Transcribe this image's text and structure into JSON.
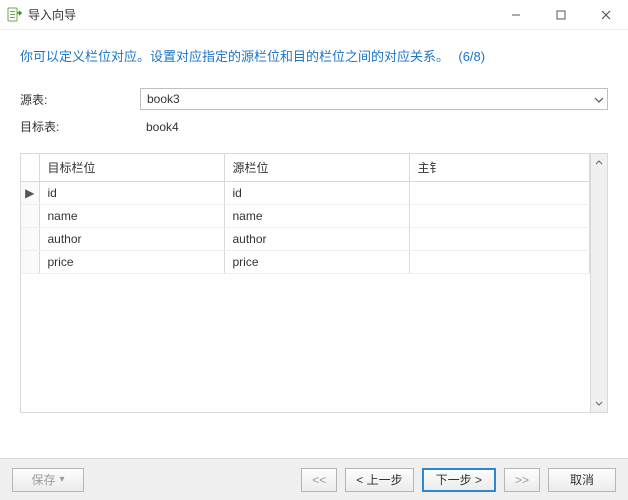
{
  "window": {
    "title": "导入向导"
  },
  "description": {
    "text": "你可以定义栏位对应。设置对应指定的源栏位和目的栏位之间的对应关系。",
    "step": "(6/8)"
  },
  "form": {
    "source_label": "源表:",
    "source_value": "book3",
    "target_label": "目标表:",
    "target_value": "book4"
  },
  "table": {
    "headers": {
      "target": "目标栏位",
      "source": "源栏位",
      "pk": "主钅"
    },
    "rows": [
      {
        "target": "id",
        "source": "id",
        "current": true
      },
      {
        "target": "name",
        "source": "name",
        "current": false
      },
      {
        "target": "author",
        "source": "author",
        "current": false
      },
      {
        "target": "price",
        "source": "price",
        "current": false
      }
    ]
  },
  "footer": {
    "save": "保存",
    "first": "<<",
    "prev": "< 上一步",
    "next": "下一步 >",
    "last": ">>",
    "cancel": "取消"
  },
  "icons": {
    "pointer": "▶"
  }
}
